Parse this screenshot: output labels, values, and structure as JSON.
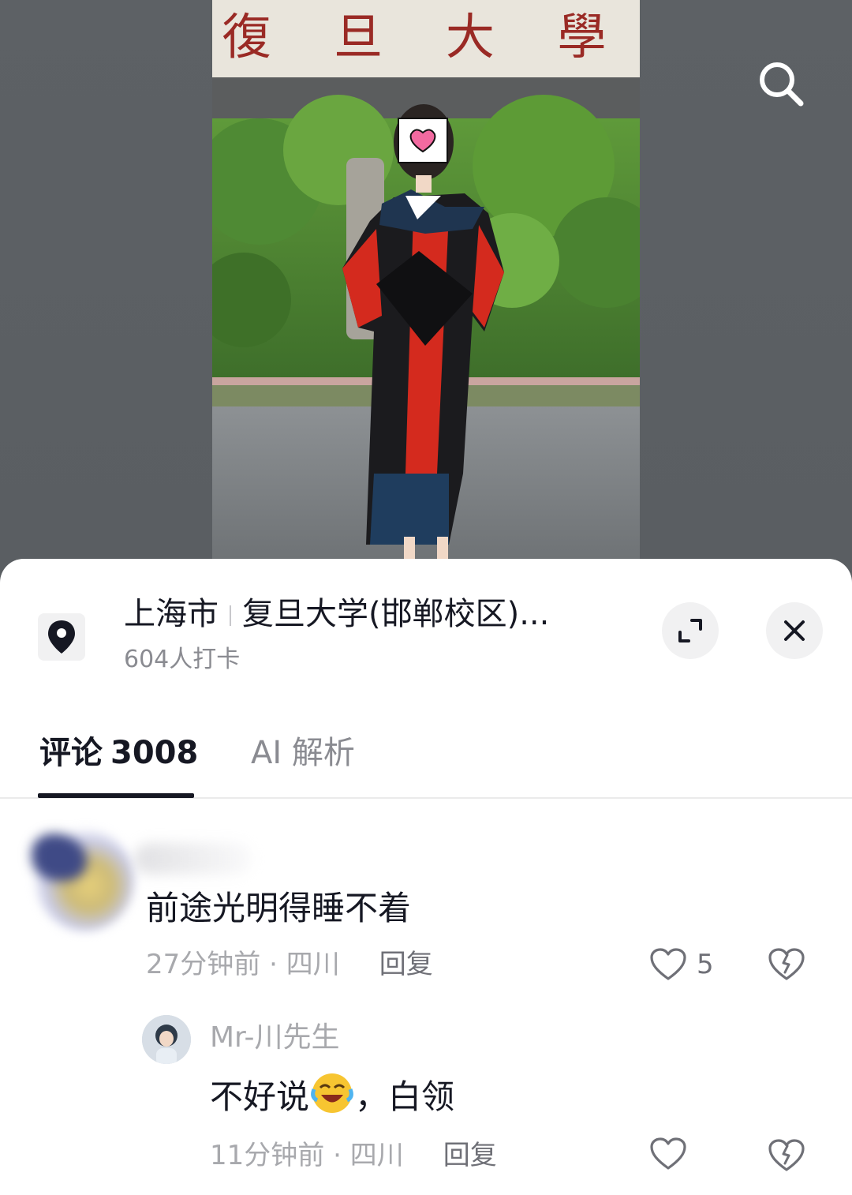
{
  "photo": {
    "gate_text": "復 旦 大 學",
    "description_icon": "graduation-photo"
  },
  "header": {
    "search_icon": "search-icon"
  },
  "location": {
    "icon": "location-pin-icon",
    "city": "上海市",
    "place": "复旦大学(邯郸校区)...",
    "checkins": "604人打卡",
    "expand_icon": "expand-icon",
    "close_icon": "close-icon"
  },
  "tabs": [
    {
      "label": "评论",
      "count": "3008",
      "active": true
    },
    {
      "label": "AI 解析",
      "active": false
    }
  ],
  "comments": [
    {
      "author": "",
      "text": "前途光明得睡不着",
      "time": "27分钟前",
      "region": "四川",
      "reply_label": "回复",
      "likes": "5"
    },
    {
      "author": "Mr-川先生",
      "text_before": "不好说",
      "emoji": "laughing-crying-emoji",
      "text_after": "，白领",
      "time": "11分钟前",
      "region": "四川",
      "reply_label": "回复",
      "likes": ""
    }
  ],
  "meta_separator": "·"
}
